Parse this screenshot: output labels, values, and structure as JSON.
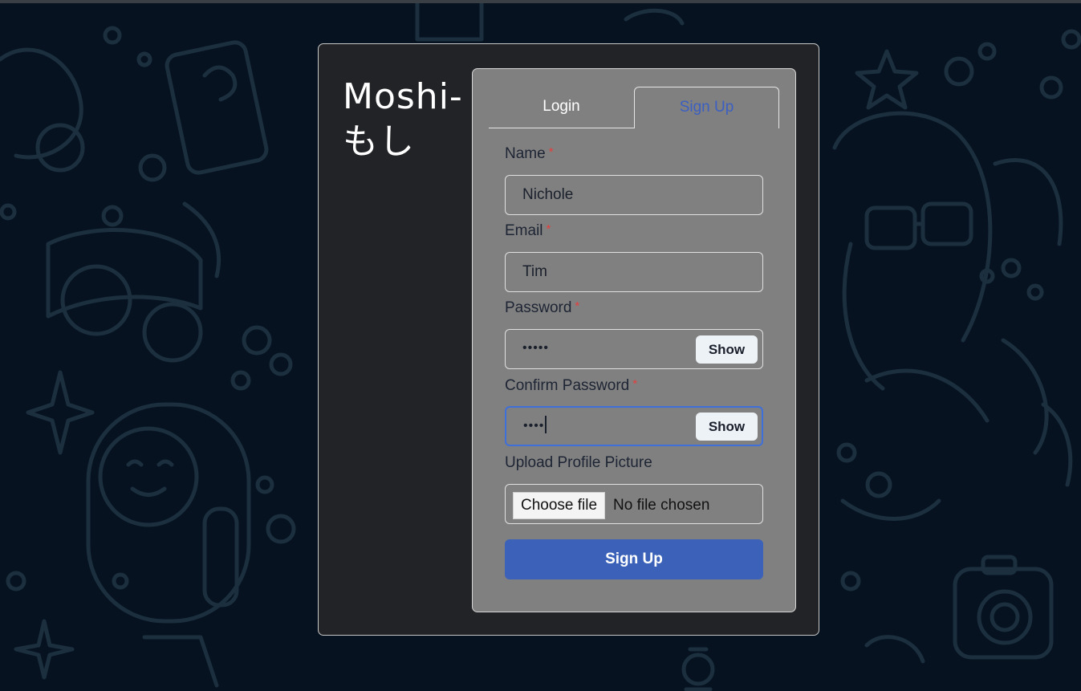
{
  "brand": {
    "line1": "Moshi-",
    "line2": "もし"
  },
  "tabs": [
    {
      "label": "Login",
      "active": false
    },
    {
      "label": "Sign Up",
      "active": true
    }
  ],
  "form": {
    "name": {
      "label": "Name",
      "required_mark": "*",
      "value": "Nichole"
    },
    "email": {
      "label": "Email",
      "required_mark": "*",
      "value": "Tim"
    },
    "password": {
      "label": "Password",
      "required_mark": "*",
      "masked_value": "•••••",
      "toggle_label": "Show"
    },
    "confirm_password": {
      "label": "Confirm Password",
      "required_mark": "*",
      "masked_value": "••••",
      "toggle_label": "Show"
    },
    "upload": {
      "label": "Upload Profile Picture",
      "button_label": "Choose file",
      "status": "No file chosen"
    },
    "submit_label": "Sign Up"
  },
  "colors": {
    "page_background": "#06121f",
    "card_background": "#222326",
    "panel_background": "#808080",
    "accent": "#3b62b8",
    "active_tab_text": "#3b5fc2",
    "required_mark": "#e53e3e",
    "focus_ring": "#3f6fd8"
  }
}
